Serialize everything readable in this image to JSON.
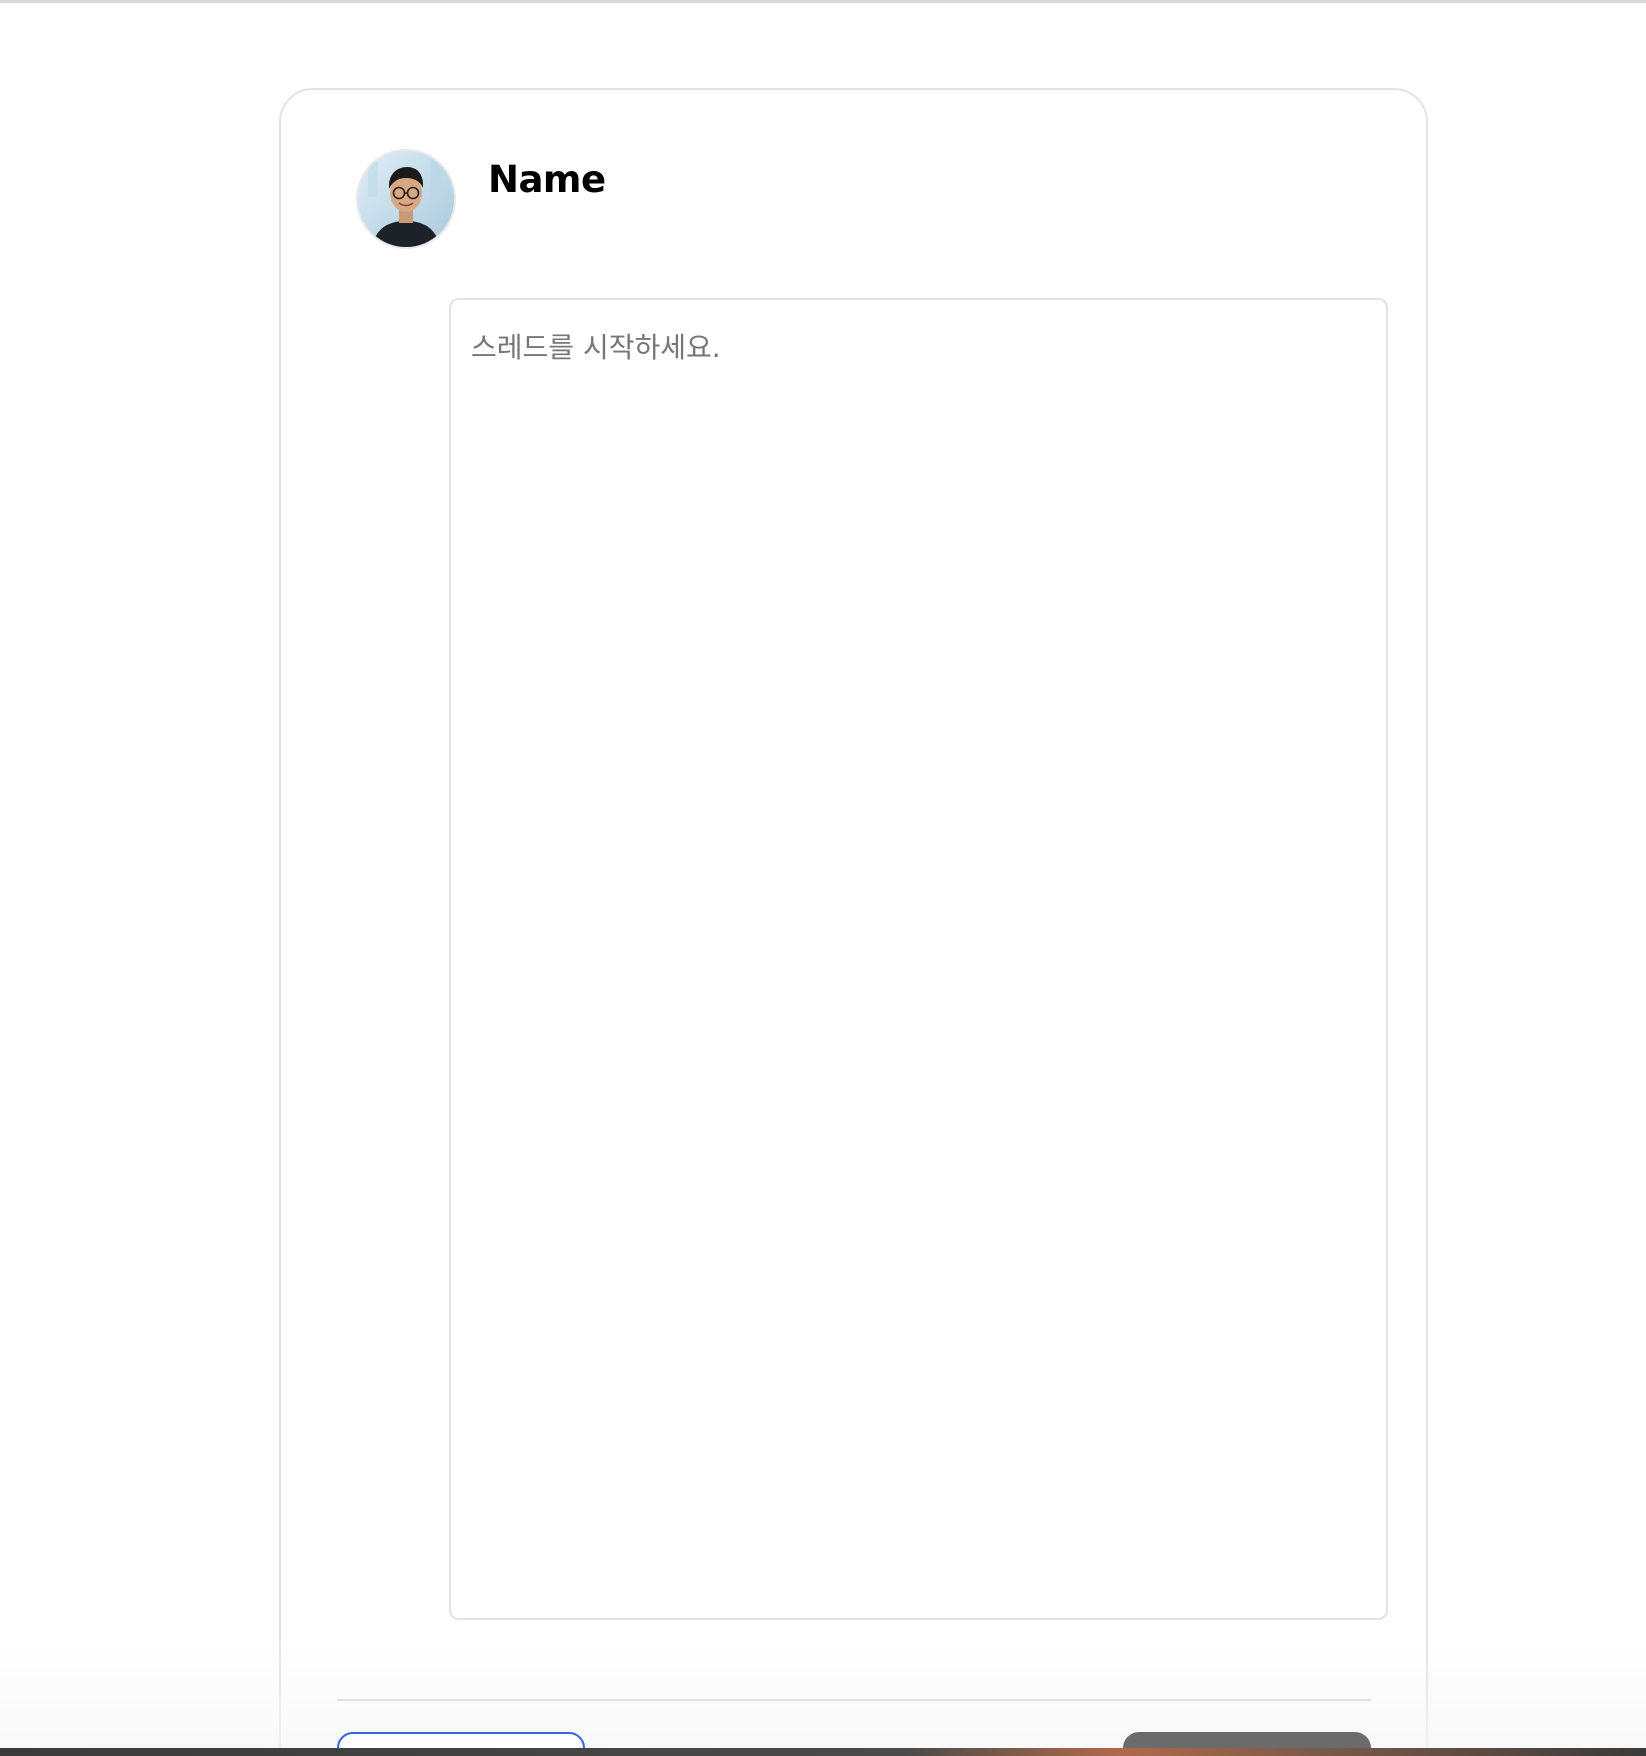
{
  "author": {
    "name": "Name",
    "avatar_icon": "user-avatar-photo"
  },
  "composer": {
    "placeholder": "스레드를 시작하세요.",
    "value": ""
  },
  "footer": {
    "secondary_button_label": "",
    "primary_button_label": ""
  },
  "colors": {
    "card_border": "#e3e3e3",
    "secondary_button_border": "#3565d8",
    "primary_button_fill": "#6b6b6b",
    "placeholder_text": "#767676"
  }
}
